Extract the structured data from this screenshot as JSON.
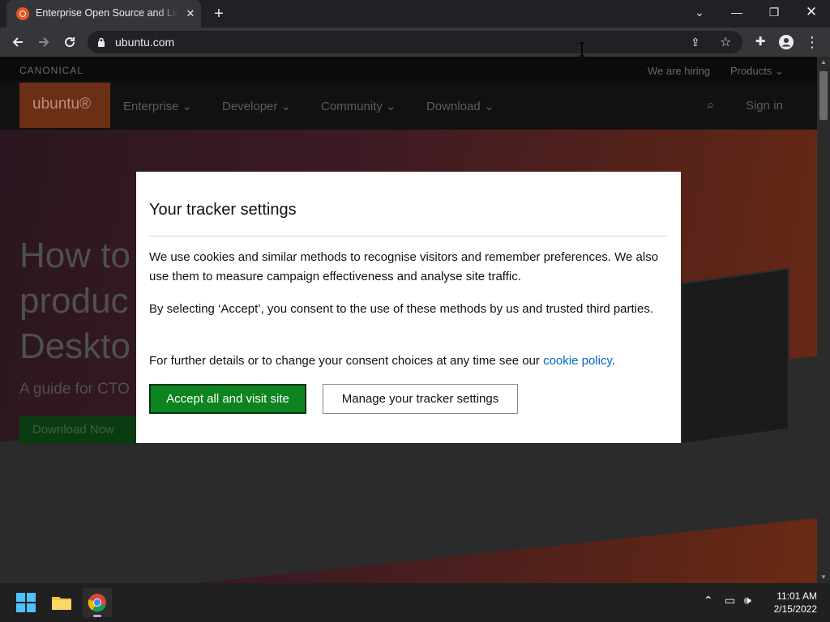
{
  "browser": {
    "tab_title": "Enterprise Open Source and Linux | Ubuntu",
    "tab_close": "✕",
    "new_tab": "+",
    "url": "ubuntu.com"
  },
  "site": {
    "brand": "CANONICAL",
    "top_links": [
      "We are hiring",
      "Products"
    ],
    "logo": "ubuntu®",
    "nav": [
      "Enterprise",
      "Developer",
      "Community",
      "Download"
    ],
    "sign_in": "Sign in",
    "hero_lines": [
      "How to",
      "produc",
      "Deskto"
    ],
    "hero_sub": "A guide for CTO",
    "hero_button": "Download Now"
  },
  "modal": {
    "title": "Your tracker settings",
    "p1": "We use cookies and similar methods to recognise visitors and remember preferences. We also use them to measure campaign effectiveness and analyse site traffic.",
    "p2": "By selecting ‘Accept’, you consent to the use of these methods by us and trusted third parties.",
    "p3_before": "For further details or to change your consent choices at any time see our ",
    "p3_link": "cookie policy",
    "p3_after": ".",
    "accept_button": "Accept all and visit site",
    "manage_button": "Manage your tracker settings"
  },
  "taskbar": {
    "time": "11:01 AM",
    "date": "2/15/2022"
  },
  "colors": {
    "ubuntu_orange": "#e95420",
    "accept_green": "#0e8420",
    "link_blue": "#0066cc"
  }
}
